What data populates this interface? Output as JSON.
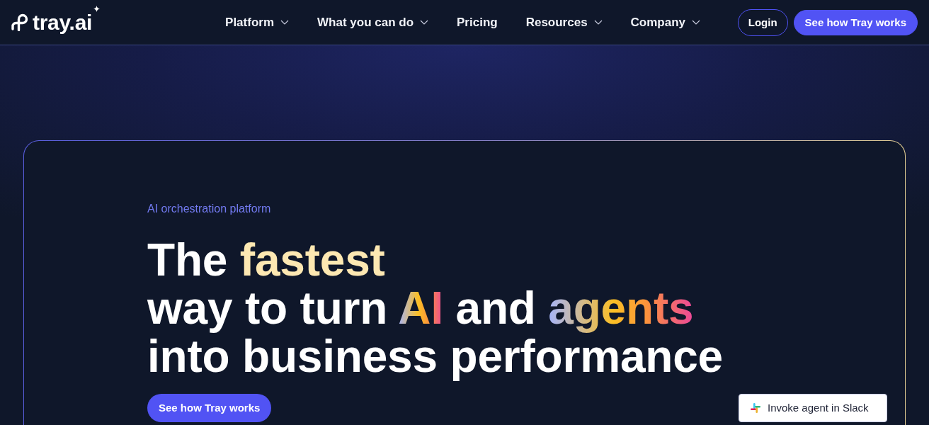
{
  "nav": {
    "logo": "tray.ai",
    "items": [
      {
        "label": "Platform",
        "dropdown": true
      },
      {
        "label": "What you can do",
        "dropdown": true
      },
      {
        "label": "Pricing",
        "dropdown": false
      },
      {
        "label": "Resources",
        "dropdown": true
      },
      {
        "label": "Company",
        "dropdown": true
      }
    ],
    "buttons": [
      {
        "label": "Login",
        "kind": "outline"
      },
      {
        "label": "See how Tray works",
        "kind": "primary"
      }
    ]
  },
  "hero": {
    "eyebrow": "AI orchestration platform",
    "headline": [
      [
        {
          "text": "The ",
          "kind": "plain"
        },
        {
          "text": "fastest",
          "kind": "accent"
        }
      ],
      [
        {
          "text": "way to turn ",
          "kind": "plain"
        },
        {
          "text": "AI",
          "kind": "gradient"
        },
        {
          "text": " and ",
          "kind": "plain"
        },
        {
          "text": "agents",
          "kind": "gradient"
        }
      ],
      [
        {
          "text": "into business performance",
          "kind": "plain"
        }
      ]
    ],
    "cta": "See how Tray works",
    "chat_card": {
      "label": "Invoke agent in Slack"
    }
  }
}
